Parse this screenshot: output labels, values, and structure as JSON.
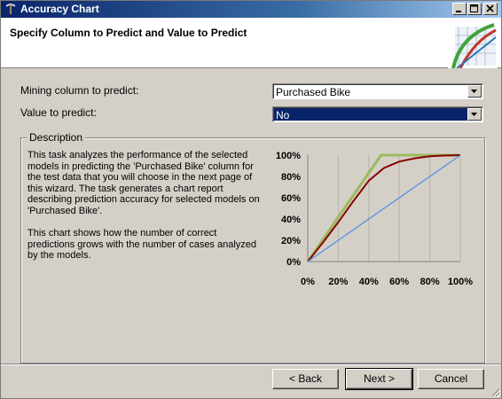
{
  "window": {
    "title": "Accuracy Chart",
    "controls": [
      "minimize",
      "maximize",
      "close"
    ]
  },
  "header": {
    "title": "Specify Column to Predict and Value to Predict"
  },
  "form": {
    "mining_column_label": "Mining column to predict:",
    "mining_column_value": "Purchased Bike",
    "value_label": "Value to predict:",
    "value_value": "No"
  },
  "description": {
    "legend": "Description",
    "paragraph1": "This task analyzes the performance of the selected models in predicting the 'Purchased Bike' column for the test data that you will choose in the next page of this wizard. The task generates a chart report describing prediction accuracy for selected models on 'Purchased Bike'.",
    "paragraph2": "This chart shows how the number of correct predictions grows with the number of cases analyzed by the models."
  },
  "chart_data": {
    "type": "line",
    "title": "",
    "xlabel": "",
    "ylabel": "",
    "x_ticks": [
      "0%",
      "20%",
      "40%",
      "60%",
      "80%",
      "100%"
    ],
    "y_ticks": [
      "0%",
      "20%",
      "40%",
      "60%",
      "80%",
      "100%"
    ],
    "xlim": [
      0,
      100
    ],
    "ylim": [
      0,
      100
    ],
    "grid": "vertical",
    "colors": [
      "#9bbb59",
      "#8b0000",
      "#4a90e2"
    ],
    "series": [
      {
        "x": [
          0,
          48,
          100
        ],
        "y": [
          0,
          100,
          100
        ]
      },
      {
        "x": [
          0,
          10,
          20,
          30,
          40,
          50,
          60,
          70,
          80,
          90,
          100
        ],
        "y": [
          0,
          18,
          37,
          57,
          76,
          88,
          94,
          97,
          99,
          99.7,
          100
        ]
      },
      {
        "x": [
          0,
          100
        ],
        "y": [
          0,
          100
        ]
      }
    ]
  },
  "buttons": {
    "back": "< Back",
    "next": "Next >",
    "cancel": "Cancel"
  }
}
